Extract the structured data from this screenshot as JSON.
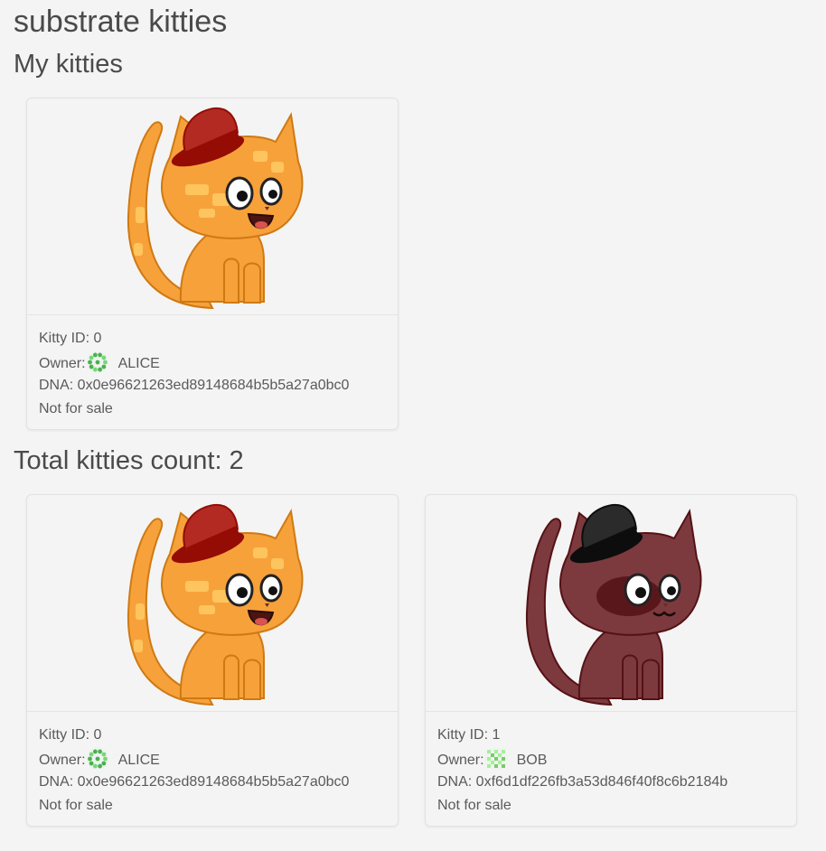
{
  "app": {
    "title": "substrate kitties"
  },
  "my_kitties": {
    "heading": "My kitties",
    "cards": [
      {
        "id_label": "Kitty ID: 0",
        "owner_label": "Owner:",
        "owner_name": "ALICE",
        "dna_label": "DNA: 0x0e96621263ed89148684b5b5a27a0bc0",
        "sale_status": "Not for sale",
        "cat_color": "#f7a13b",
        "hat_color": "#b22a22",
        "avatar_color": "#4caf50"
      }
    ]
  },
  "all_kitties": {
    "heading": "Total kitties count: 2",
    "cards": [
      {
        "id_label": "Kitty ID: 0",
        "owner_label": "Owner:",
        "owner_name": "ALICE",
        "dna_label": "DNA: 0x0e96621263ed89148684b5b5a27a0bc0",
        "sale_status": "Not for sale",
        "cat_color": "#f7a13b",
        "hat_color": "#b22a22",
        "avatar_color": "#4caf50"
      },
      {
        "id_label": "Kitty ID: 1",
        "owner_label": "Owner:",
        "owner_name": "BOB",
        "dna_label": "DNA: 0xf6d1df226fb3a53d846f40f8c6b2184b",
        "sale_status": "Not for sale",
        "cat_color": "#7d3a3e",
        "hat_color": "#2b2b2b",
        "avatar_color": "#7bc96f"
      }
    ]
  }
}
